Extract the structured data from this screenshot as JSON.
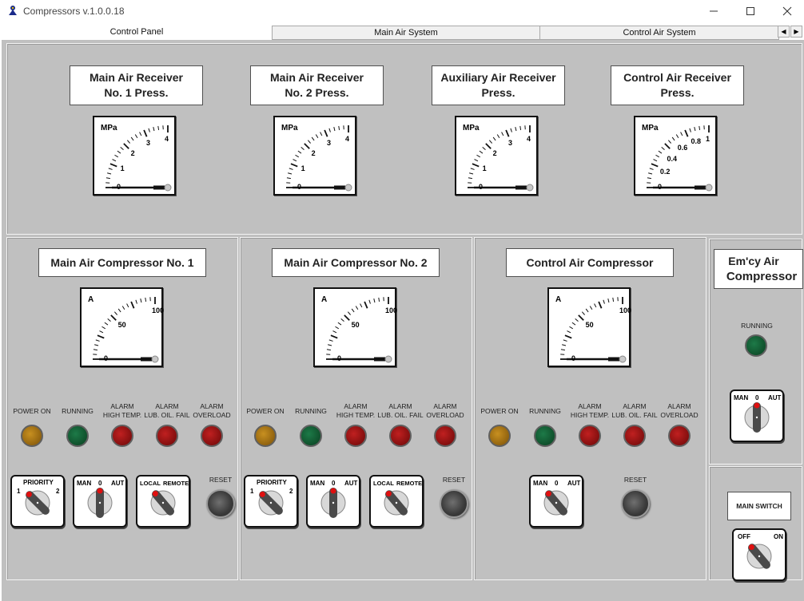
{
  "window": {
    "title": "Compressors  v.1.0.0.18",
    "minimize_icon": "minimize-icon",
    "maximize_icon": "maximize-icon",
    "close_icon": "close-icon"
  },
  "tabs": [
    {
      "label": "Control Panel",
      "active": true
    },
    {
      "label": "Main Air System",
      "active": false
    },
    {
      "label": "Control Air System",
      "active": false
    }
  ],
  "receivers": [
    {
      "label1": "Main Air Receiver",
      "label2": "No. 1 Press.",
      "unit": "MPa",
      "ticks": [
        "0",
        "1",
        "2",
        "3",
        "4"
      ]
    },
    {
      "label1": "Main Air Receiver",
      "label2": "No. 2 Press.",
      "unit": "MPa",
      "ticks": [
        "0",
        "1",
        "2",
        "3",
        "4"
      ]
    },
    {
      "label1": "Auxiliary Air Receiver",
      "label2": "Press.",
      "unit": "MPa",
      "ticks": [
        "0",
        "1",
        "2",
        "3",
        "4"
      ]
    },
    {
      "label1": "Control Air Receiver",
      "label2": "Press.",
      "unit": "MPa",
      "ticks": [
        "0",
        "0.2",
        "0.4",
        "0.6",
        "0.8",
        "1"
      ]
    }
  ],
  "compressors": [
    {
      "title": "Main Air Compressor No. 1",
      "unit": "A",
      "ticks": [
        "0",
        "50",
        "100"
      ]
    },
    {
      "title": "Main Air Compressor No. 2",
      "unit": "A",
      "ticks": [
        "0",
        "50",
        "100"
      ]
    },
    {
      "title": "Control Air Compressor",
      "unit": "A",
      "ticks": [
        "0",
        "50",
        "100"
      ]
    }
  ],
  "lamps": {
    "power_on": "POWER ON",
    "running": "RUNNING",
    "alarm_high_temp_1": "ALARM",
    "alarm_high_temp_2": "HIGH TEMP.",
    "alarm_lub_1": "ALARM",
    "alarm_lub_2": "LUB. OIL. FAIL",
    "alarm_overload_1": "ALARM",
    "alarm_overload_2": "OVERLOAD"
  },
  "switches": {
    "priority": "PRIORITY",
    "priority_1": "1",
    "priority_2": "2",
    "man": "MAN",
    "zero": "0",
    "aut": "AUT",
    "local": "LOCAL",
    "remote": "REMOTE",
    "reset": "RESET",
    "off": "OFF",
    "on": "ON"
  },
  "emergency": {
    "title1": "Em'cy Air",
    "title2": "Compressor",
    "running": "RUNNING"
  },
  "main_switch": {
    "label": "MAIN SWITCH"
  },
  "colors": {
    "panel_bg": "#c0c0c0",
    "lamp_power": "#b07a10",
    "lamp_running": "#0e5a2e",
    "lamp_alarm": "#a01010",
    "knob_red": "#e01010"
  }
}
